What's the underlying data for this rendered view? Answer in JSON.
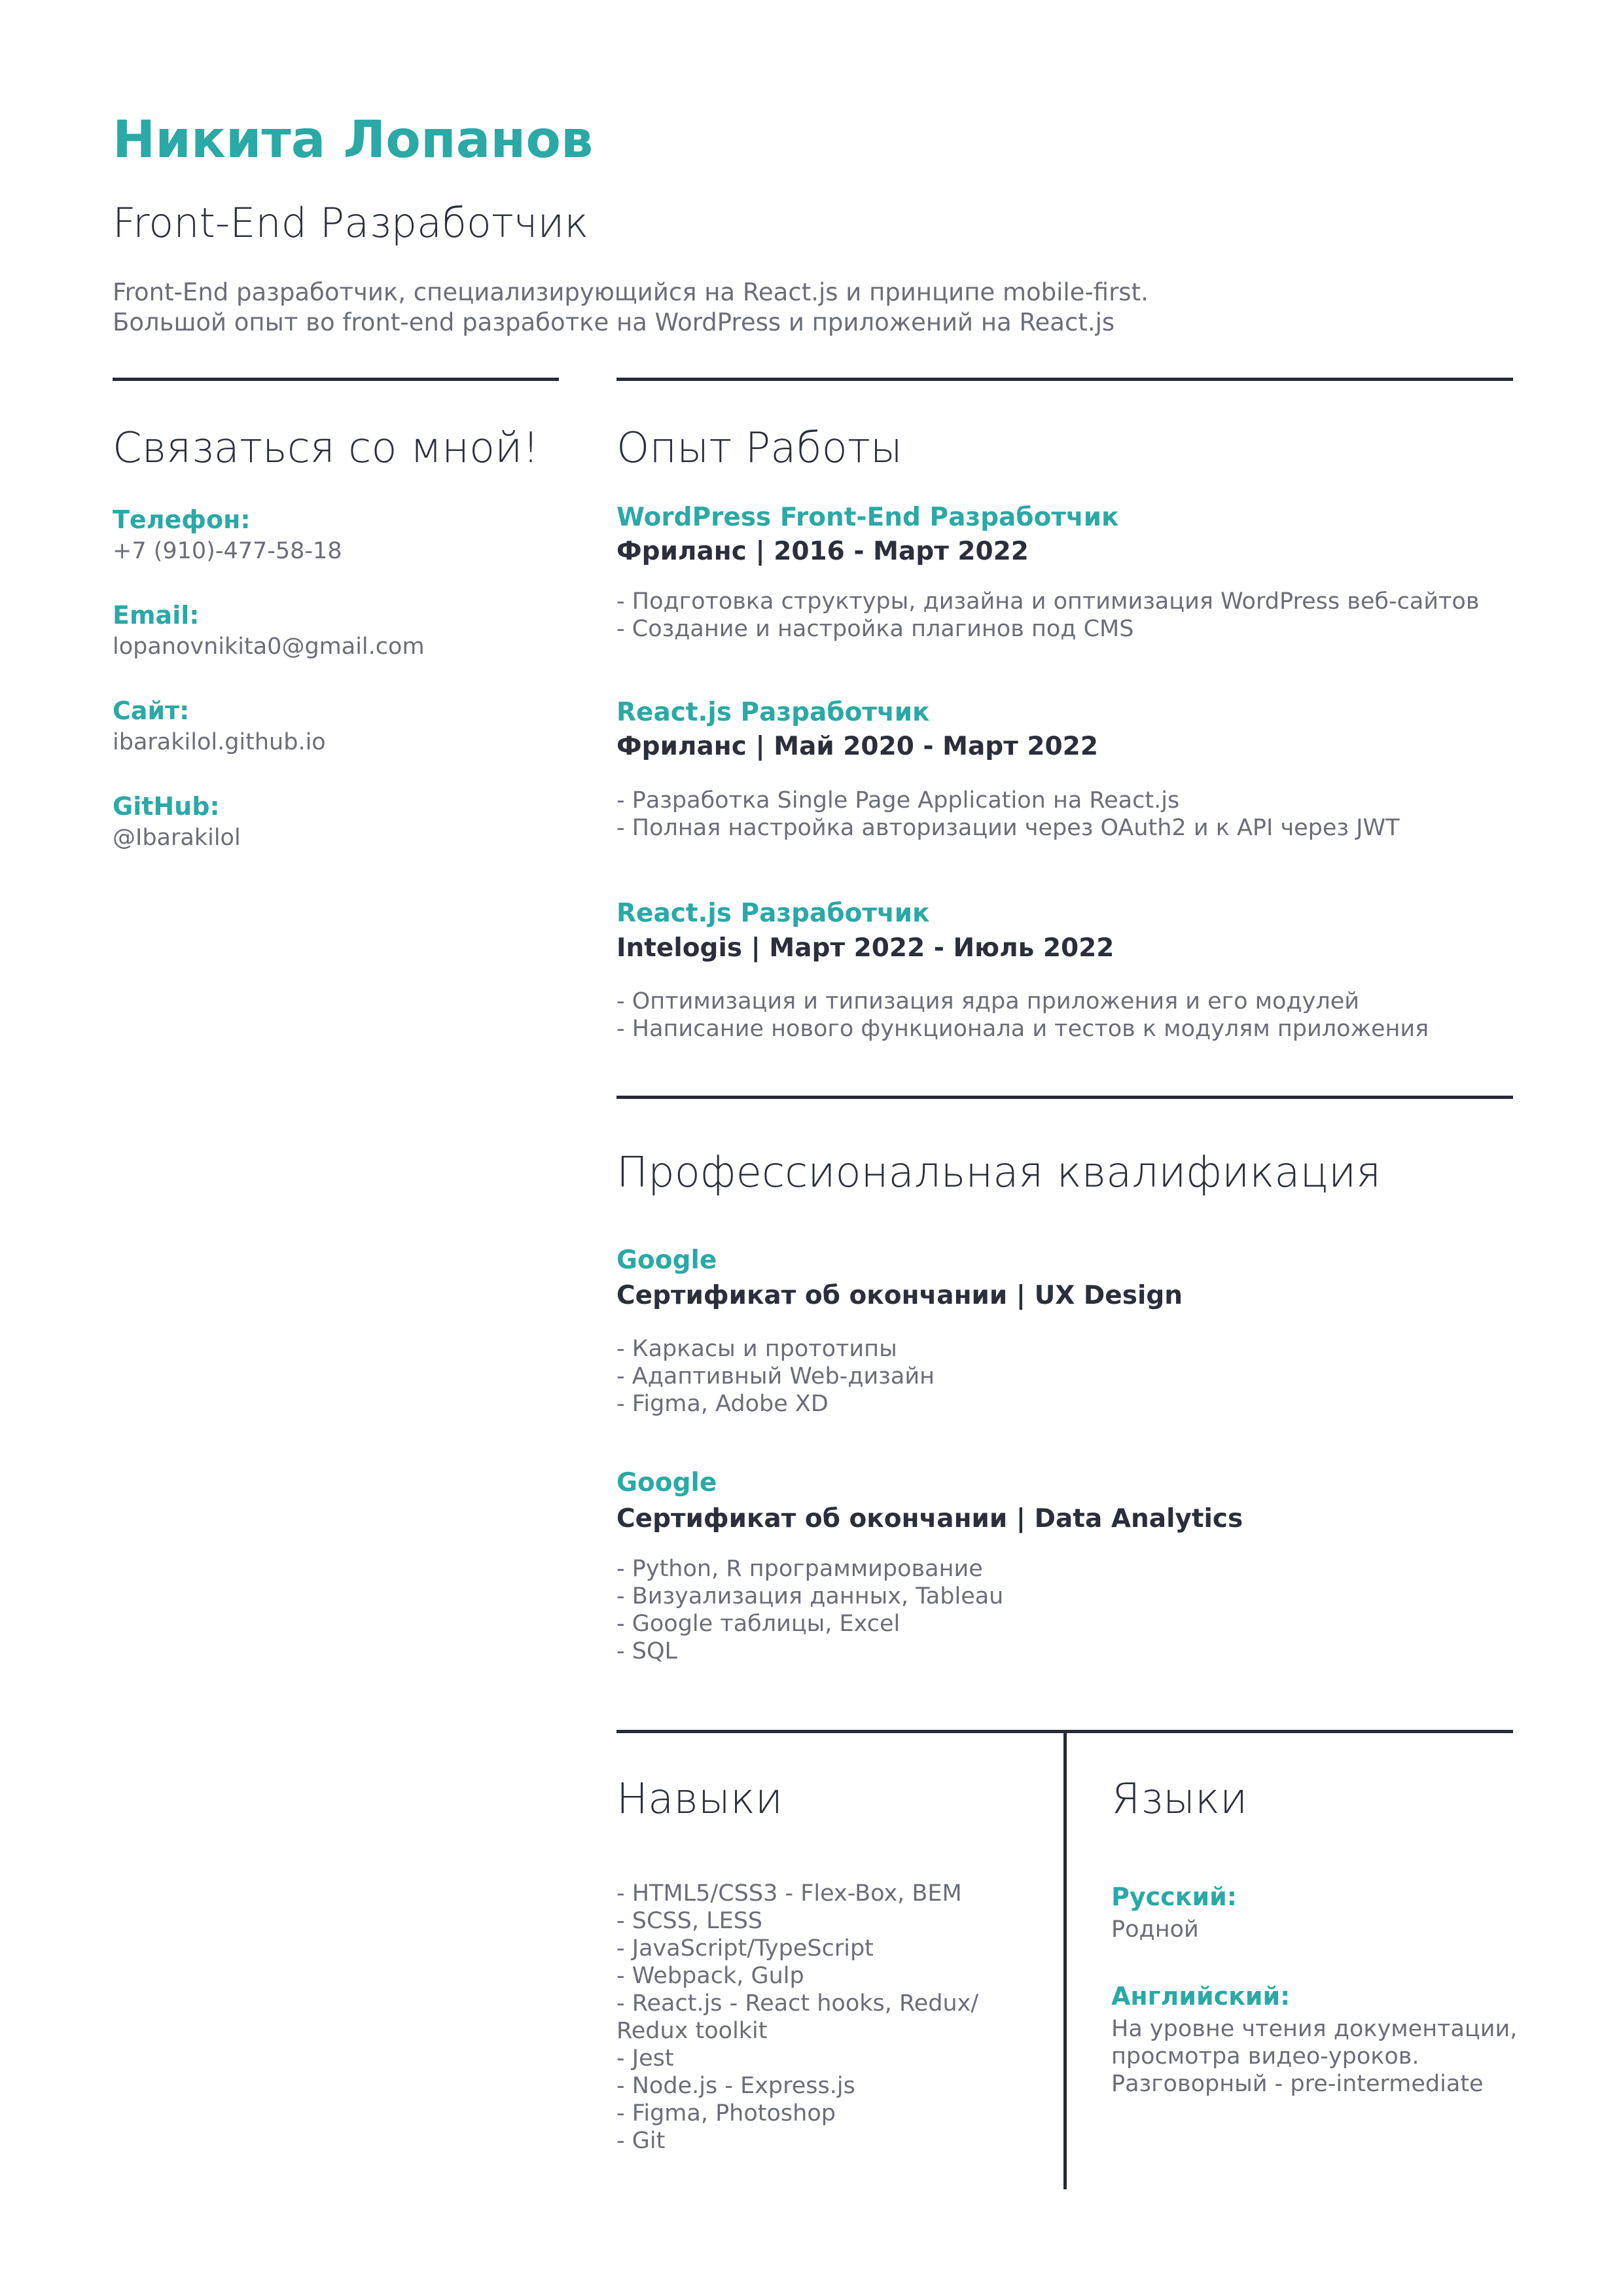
{
  "header": {
    "name": "Никита Лопанов",
    "title": "Front-End Разработчик",
    "summary": [
      "Front-End разработчик, специализирующийся на React.js и принципе mobile-first.",
      "Большой опыт во front-end разработке на WordPress и приложений на React.js"
    ]
  },
  "contacts": {
    "heading": "Связаться со мной!",
    "items": [
      {
        "label": "Телефон:",
        "value": "+7 (910)-477-58-18"
      },
      {
        "label": "Email:",
        "value": "lopanovnikita0@gmail.com"
      },
      {
        "label": "Сайт:",
        "value": "ibarakilol.github.io"
      },
      {
        "label": "GitHub:",
        "value": "@Ibarakilol"
      }
    ]
  },
  "experience": {
    "heading": "Опыт Работы",
    "jobs": [
      {
        "role": "WordPress Front-End Разработчик",
        "org": "Фриланс | 2016 - Март 2022",
        "bullets": [
          "- Подготовка структуры, дизайна и оптимизация WordPress веб-сайтов",
          "- Создание и настройка плагинов под CMS"
        ]
      },
      {
        "role": "React.js Разработчик",
        "org": "Фриланс | Май 2020 - Март 2022",
        "bullets": [
          "- Разработка Single Page Application на React.js",
          "- Полная настройка авторизации через OAuth2 и к API через JWT"
        ]
      },
      {
        "role": "React.js Разработчик",
        "org": "Intelogis | Март 2022 - Июль 2022",
        "bullets": [
          "- Оптимизация и типизация ядра приложения и его модулей",
          "- Написание нового функционала и тестов к модулям приложения"
        ]
      }
    ]
  },
  "qualifications": {
    "heading": "Профессиональная квалификация",
    "items": [
      {
        "issuer": "Google",
        "title": "Сертификат об окончании | UX Design",
        "bullets": [
          "- Каркасы и прототипы",
          "- Адаптивный Web-дизайн",
          "- Figma, Adobe XD"
        ]
      },
      {
        "issuer": "Google",
        "title": "Сертификат об окончании | Data Analytics",
        "bullets": [
          "- Python, R программирование",
          "- Визуализация данных, Tableau",
          "- Google таблицы, Excel",
          "- SQL"
        ]
      }
    ]
  },
  "skills": {
    "heading": "Навыки",
    "lines": [
      "- HTML5/CSS3 - Flex-Box, BEM",
      "- SCSS, LESS",
      "- JavaScript/TypeScript",
      "- Webpack, Gulp",
      "- React.js - React hooks, Redux/",
      "Redux toolkit",
      "- Jest",
      "- Node.js - Express.js",
      "- Figma, Photoshop",
      "- Git"
    ]
  },
  "languages": {
    "heading": "Языки",
    "items": [
      {
        "label": "Русский:",
        "lines": [
          "Родной"
        ]
      },
      {
        "label": "Английский:",
        "lines": [
          "На уровне чтения документации,",
          "просмотра видео-уроков.",
          "Разговорный - pre-intermediate"
        ]
      }
    ]
  }
}
